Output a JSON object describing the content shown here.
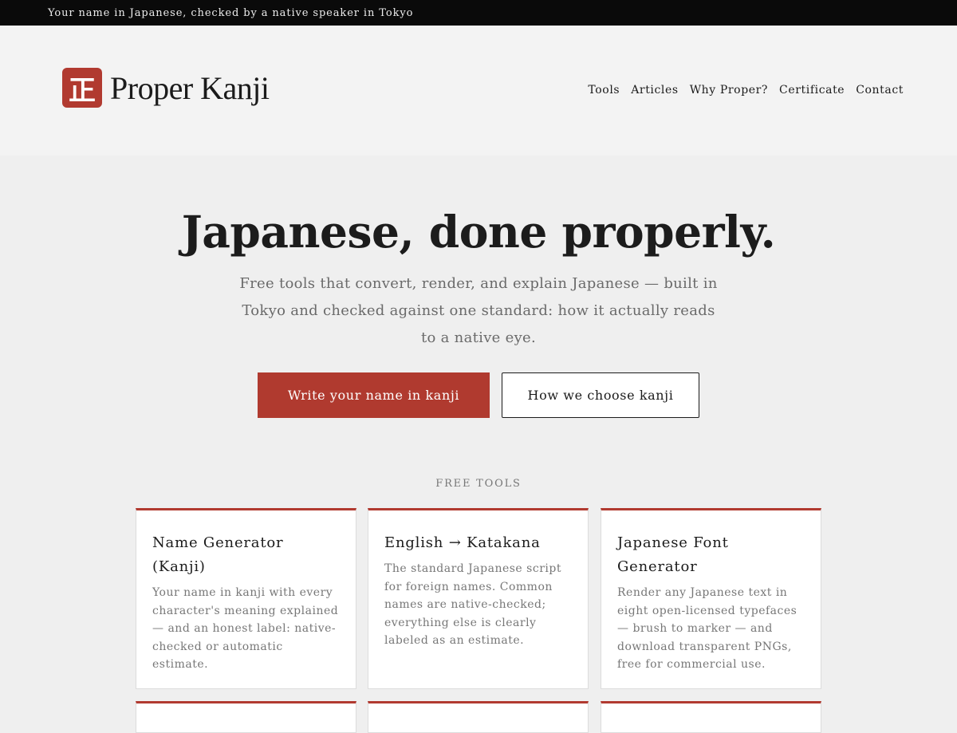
{
  "topbar": {
    "text": "Your name in Japanese, checked by a native speaker in Tokyo"
  },
  "brand": {
    "mark": "正",
    "name": "Proper Kanji"
  },
  "nav": [
    "Tools",
    "Articles",
    "Why Proper?",
    "Certificate",
    "Contact"
  ],
  "hero": {
    "title": "Japanese, done properly.",
    "subtitle": "Free tools that convert, render, and explain Japanese — built in Tokyo and checked against one standard: how it actually reads to a native eye.",
    "primary_cta": "Write your name in kanji",
    "secondary_cta": "How we choose kanji"
  },
  "tools_section": {
    "label": "FREE TOOLS",
    "cards": [
      {
        "title": "Name Generator (Kanji)",
        "description": "Your name in kanji with every character's meaning explained — and an honest label: native-checked or automatic estimate."
      },
      {
        "title": "English → Katakana",
        "description": "The standard Japanese script for foreign names. Common names are native-checked; everything else is clearly labeled as an estimate."
      },
      {
        "title": "Japanese Font Generator",
        "description": "Render any Japanese text in eight open-licensed typefaces — brush to marker — and download transparent PNGs, free for commercial use."
      }
    ]
  },
  "colors": {
    "accent": "#b13a30",
    "topbar": "#0a0a0a",
    "background": "#efefef"
  }
}
